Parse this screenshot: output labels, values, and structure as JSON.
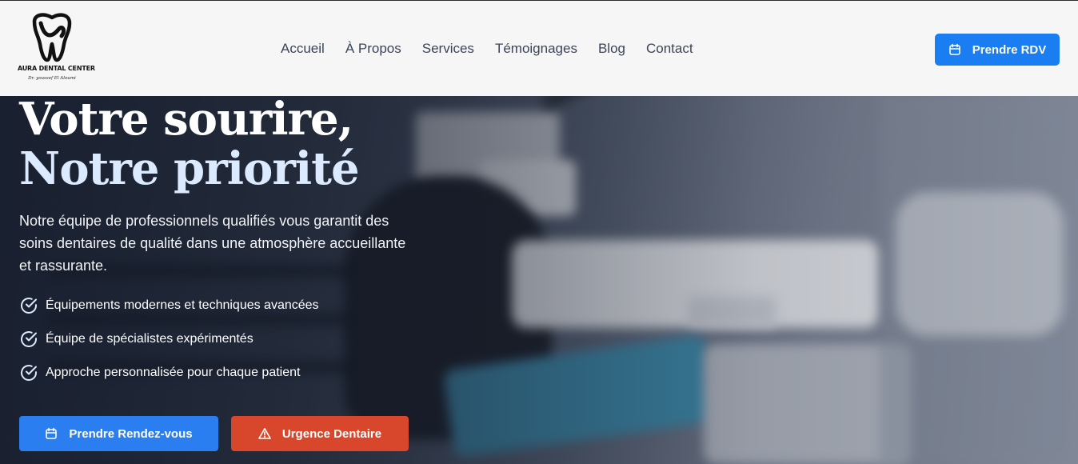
{
  "header": {
    "logo": {
      "name": "AURA DENTAL CENTER",
      "subtitle": "Dr. youssef El Aloumi"
    },
    "nav": [
      {
        "label": "Accueil"
      },
      {
        "label": "À Propos"
      },
      {
        "label": "Services"
      },
      {
        "label": "Témoignages"
      },
      {
        "label": "Blog"
      },
      {
        "label": "Contact"
      }
    ],
    "cta": {
      "label": "Prendre RDV",
      "icon": "calendar-icon"
    }
  },
  "hero": {
    "title_line1": "Votre sourire,",
    "title_line2": "Notre priorité",
    "description": "Notre équipe de professionnels qualifiés vous garantit des soins dentaires de qualité dans une atmosphère accueillante et rassurante.",
    "features": [
      {
        "label": "Équipements modernes et techniques avancées",
        "icon": "check-circle-icon"
      },
      {
        "label": "Équipe de spécialistes expérimentés",
        "icon": "check-circle-icon"
      },
      {
        "label": "Approche personnalisée pour chaque patient",
        "icon": "check-circle-icon"
      }
    ],
    "buttons": {
      "primary": {
        "label": "Prendre Rendez-vous",
        "icon": "calendar-icon"
      },
      "emergency": {
        "label": "Urgence Dentaire",
        "icon": "warning-triangle-icon"
      }
    }
  },
  "colors": {
    "primary": "#1a7ef2",
    "danger": "#d8462b",
    "nav_text": "#3a4558",
    "header_bg": "#f6f6f6"
  }
}
